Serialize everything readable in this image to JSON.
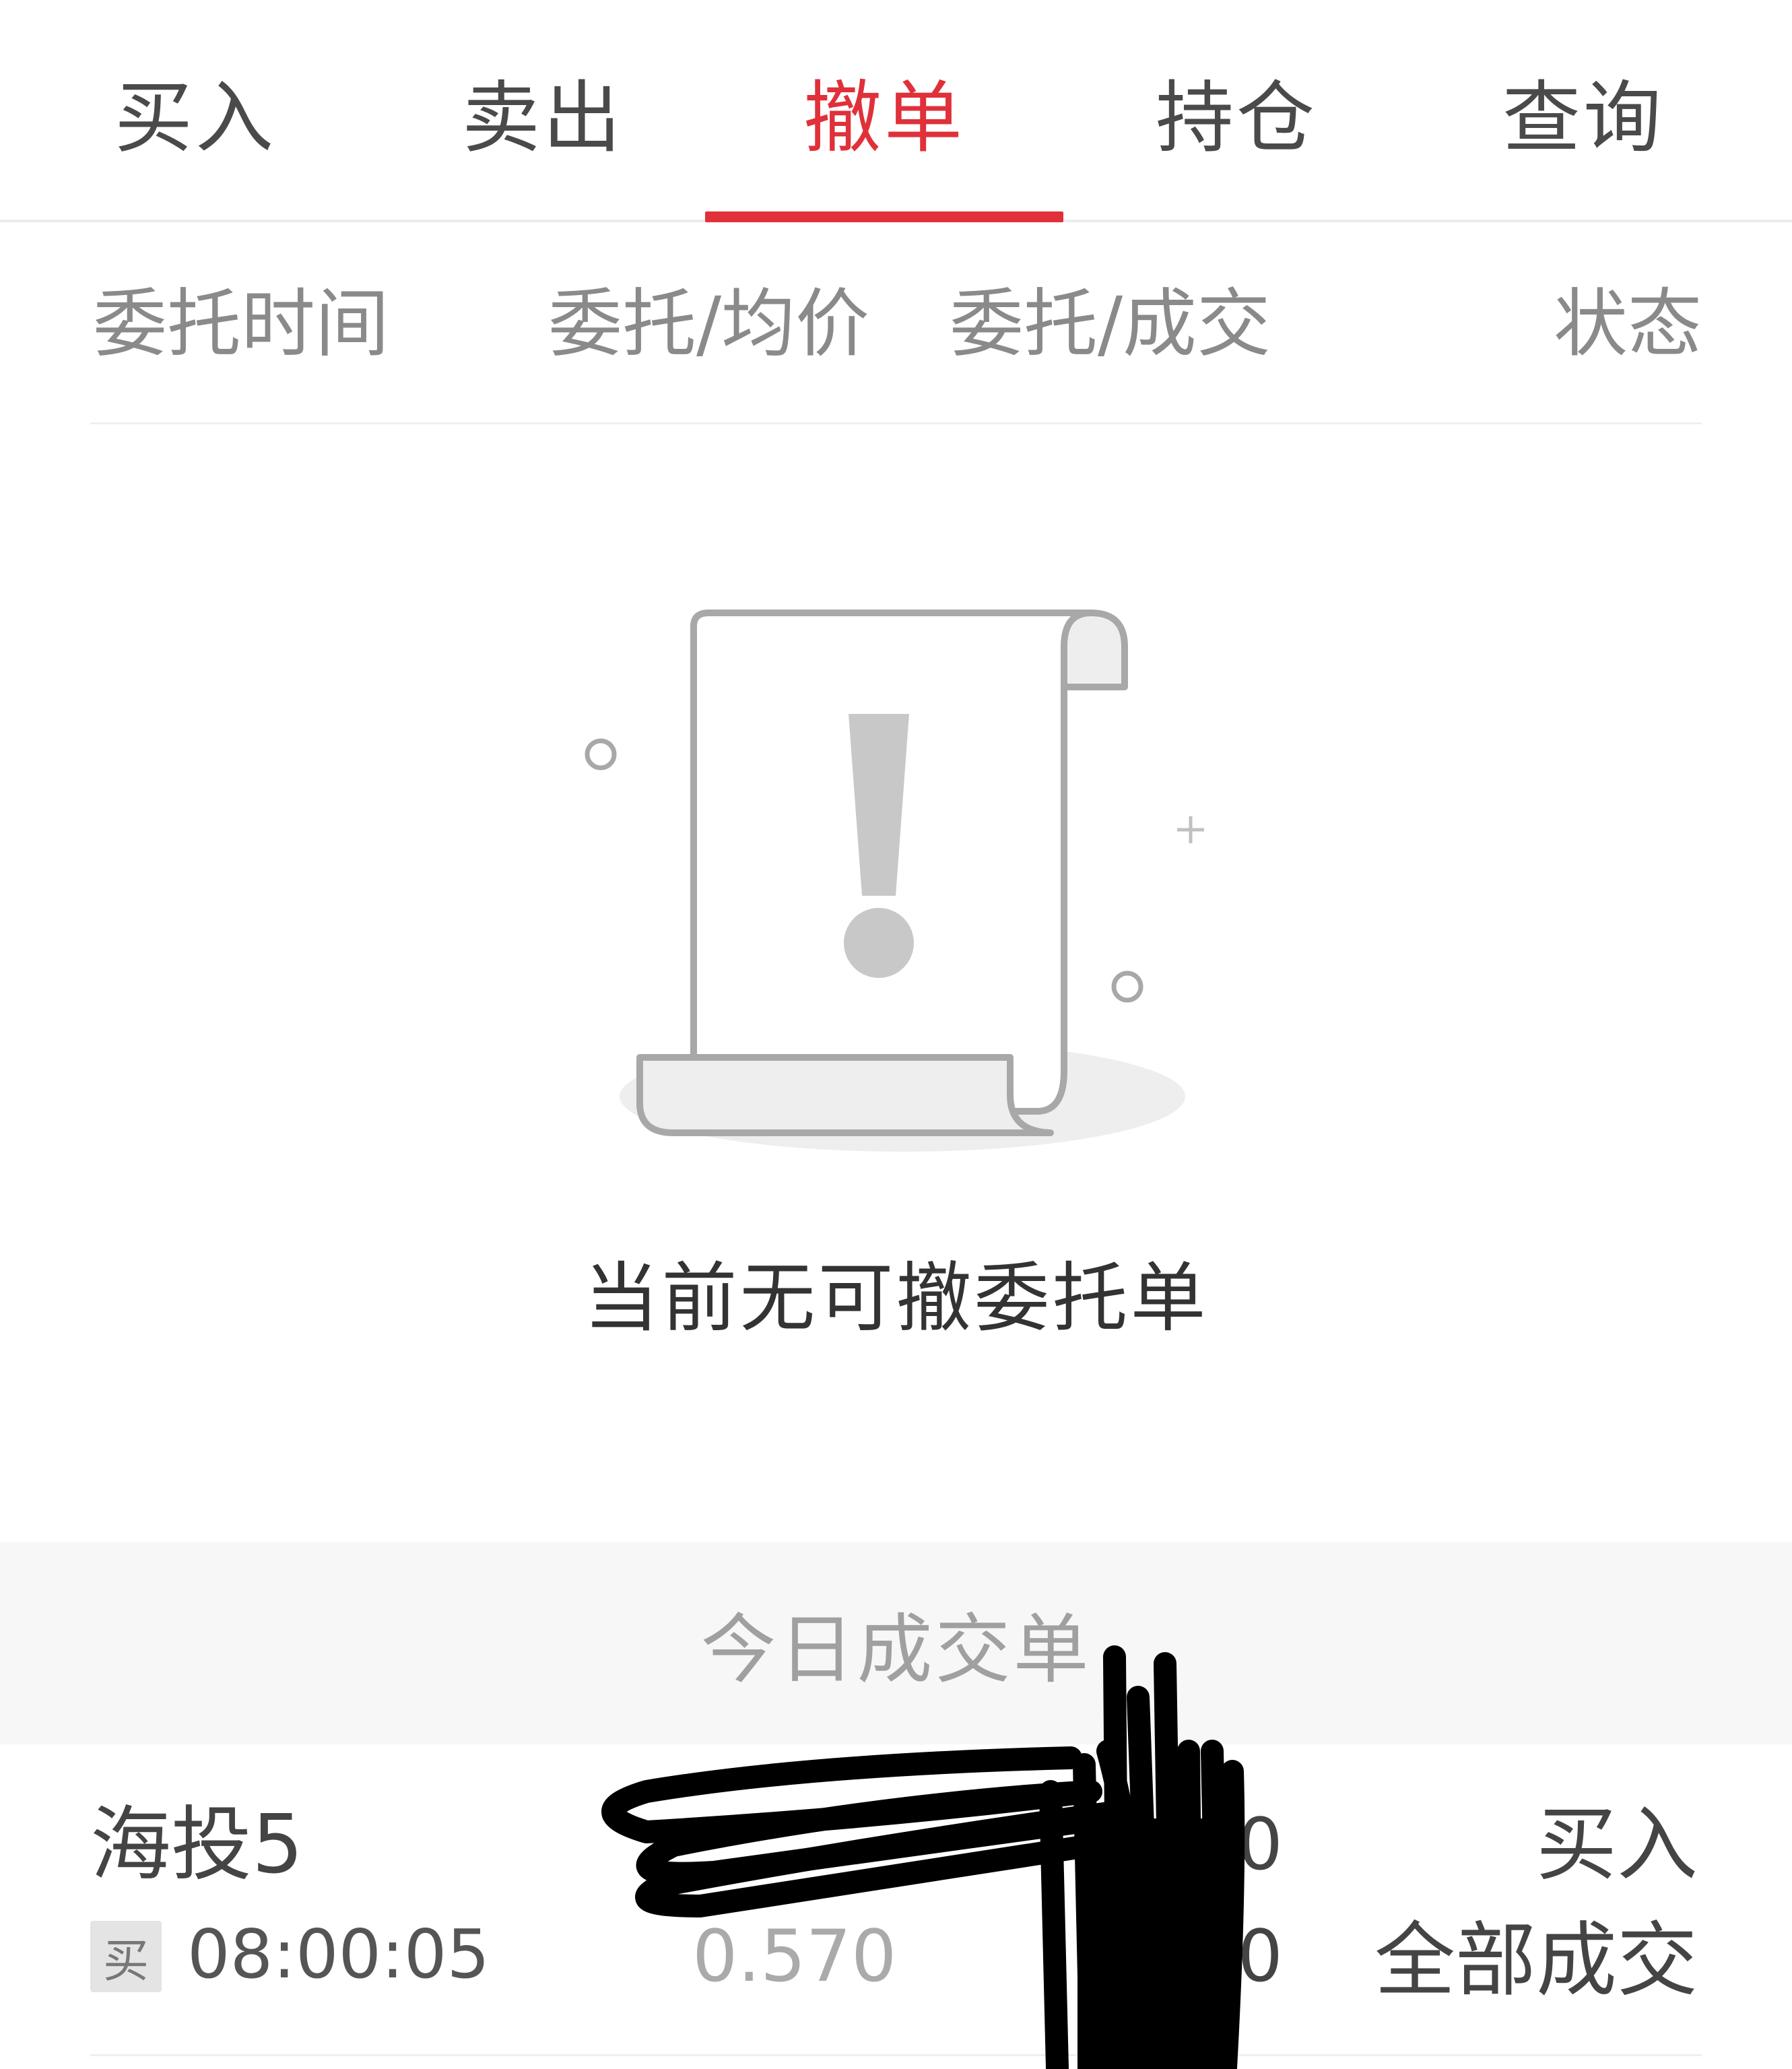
{
  "tabs": [
    {
      "label": "买入"
    },
    {
      "label": "卖出"
    },
    {
      "label": "撤单"
    },
    {
      "label": "持仓"
    },
    {
      "label": "查询"
    }
  ],
  "active_tab": "撤单",
  "columns": {
    "time": "委托时间",
    "price": "委托/均价",
    "qty": "委托/成交",
    "status": "状态"
  },
  "empty_state": {
    "message": "当前无可撤委托单",
    "illustration_icon": "document-warning-icon"
  },
  "today_section": {
    "title": "今日成交单",
    "rows": [
      {
        "name": "海投5",
        "side_badge": "买",
        "time": "08:00:05",
        "avg_price": "0.570",
        "qty_top_visible": "00",
        "qty_bottom_visible": "00",
        "direction": "买入",
        "status": "全部成交"
      }
    ]
  },
  "colors": {
    "accent": "#e0303a",
    "text_primary": "#333333",
    "text_secondary": "#8a8a8a",
    "band_bg": "#f7f7f7"
  }
}
